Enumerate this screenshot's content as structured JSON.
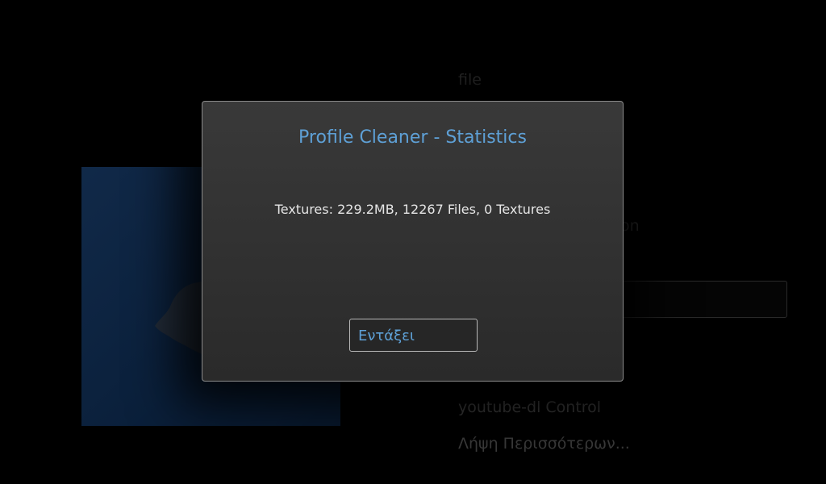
{
  "background": {
    "list_items": [
      {
        "label": "file"
      },
      {
        "label": "on"
      },
      {
        "label": "youtube-dl Control"
      },
      {
        "label": "Λήψη Περισσότερων..."
      }
    ],
    "thumbnail_icon": "paint-splash-icon",
    "thumbnail_color": "#0c2545"
  },
  "dialog": {
    "title": "Profile Cleaner - Statistics",
    "message": "Textures: 229.2MB, 12267 Files, 0 Textures",
    "ok_label": "Εντάξει",
    "accent_color": "#5ea0d6"
  }
}
